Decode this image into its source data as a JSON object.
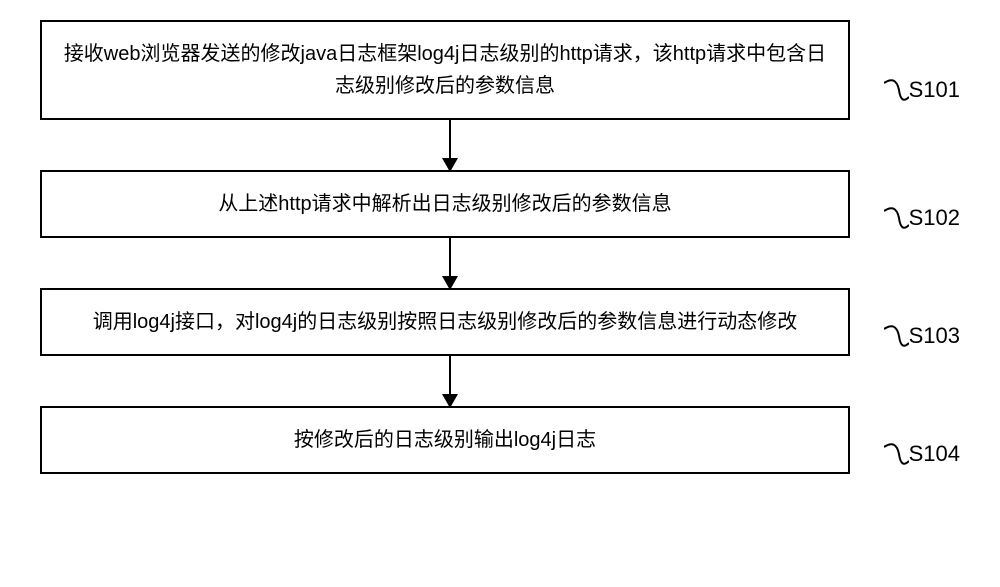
{
  "flowchart": {
    "steps": [
      {
        "id": "S101",
        "text": "接收web浏览器发送的修改java日志框架log4j日志级别的http请求，该http请求中包含日志级别修改后的参数信息"
      },
      {
        "id": "S102",
        "text": "从上述http请求中解析出日志级别修改后的参数信息"
      },
      {
        "id": "S103",
        "text": "调用log4j接口，对log4j的日志级别按照日志级别修改后的参数信息进行动态修改"
      },
      {
        "id": "S104",
        "text": "按修改后的日志级别输出log4j日志"
      }
    ]
  }
}
